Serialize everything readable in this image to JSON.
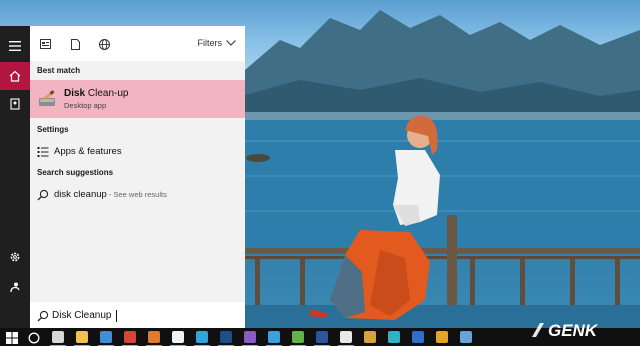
{
  "start_rail": {
    "items": [
      {
        "name": "hamburger-menu-icon",
        "active": false
      },
      {
        "name": "home-icon",
        "active": true
      },
      {
        "name": "notebook-icon",
        "active": false
      },
      {
        "name": "settings-gear-icon",
        "active": false
      },
      {
        "name": "feedback-icon",
        "active": false
      }
    ]
  },
  "search_panel": {
    "topbar": {
      "icons": [
        "apps-filter-icon",
        "documents-filter-icon",
        "web-filter-icon"
      ],
      "filters_label": "Filters"
    },
    "best_match": {
      "section_label": "Best match",
      "title_bold": "Disk",
      "title_rest": " Clean-up",
      "subtitle": "Desktop app",
      "icon": "disk-cleanup-app-icon"
    },
    "settings": {
      "section_label": "Settings",
      "items": [
        {
          "label": "Apps & features",
          "icon": "apps-features-icon"
        }
      ]
    },
    "suggestions": {
      "section_label": "Search suggestions",
      "items": [
        {
          "label": "disk cleanup",
          "hint": " - See web results",
          "icon": "search-icon"
        }
      ]
    },
    "search_box": {
      "value": "Disk Cleanup",
      "icon": "search-icon"
    }
  },
  "taskbar": {
    "start_icon": "windows-logo-icon",
    "cortana_icon": "cortana-circle-icon",
    "apps": [
      {
        "name": "task-view-icon",
        "color": "#d8d8d8"
      },
      {
        "name": "file-explorer-icon",
        "color": "#f2c14e"
      },
      {
        "name": "edge-icon",
        "color": "#3f8fd6"
      },
      {
        "name": "app-red-icon",
        "color": "#d64535"
      },
      {
        "name": "app-orange-icon",
        "color": "#e07a2c"
      },
      {
        "name": "app-circle-icon",
        "color": "#f2f2f2"
      },
      {
        "name": "telegram-icon",
        "color": "#2ea6dd"
      },
      {
        "name": "photoshop-icon",
        "color": "#1f4f8a"
      },
      {
        "name": "app-purple-icon",
        "color": "#8a5bc4"
      },
      {
        "name": "app-bird-icon",
        "color": "#3c9fe0"
      },
      {
        "name": "app-green-icon",
        "color": "#66b24a"
      },
      {
        "name": "word-icon",
        "color": "#2b579a"
      },
      {
        "name": "app-white-icon",
        "color": "#e8e8e8"
      },
      {
        "name": "app-multicolor-icon",
        "color": "#d6a43a"
      },
      {
        "name": "app-cyan-icon",
        "color": "#2fb3c9"
      },
      {
        "name": "app-blue2-icon",
        "color": "#2e6fce"
      },
      {
        "name": "chrome-icon",
        "color": "#e4a426"
      },
      {
        "name": "app-store-icon",
        "color": "#6aa3d9"
      }
    ]
  },
  "watermark": {
    "text": "GENK"
  },
  "colors": {
    "rail": "#1f1f1f",
    "rail_active": "#b3153e",
    "panel": "#f2f2f2",
    "best_match_highlight": "#f3b4c1",
    "taskbar": "#101010"
  }
}
